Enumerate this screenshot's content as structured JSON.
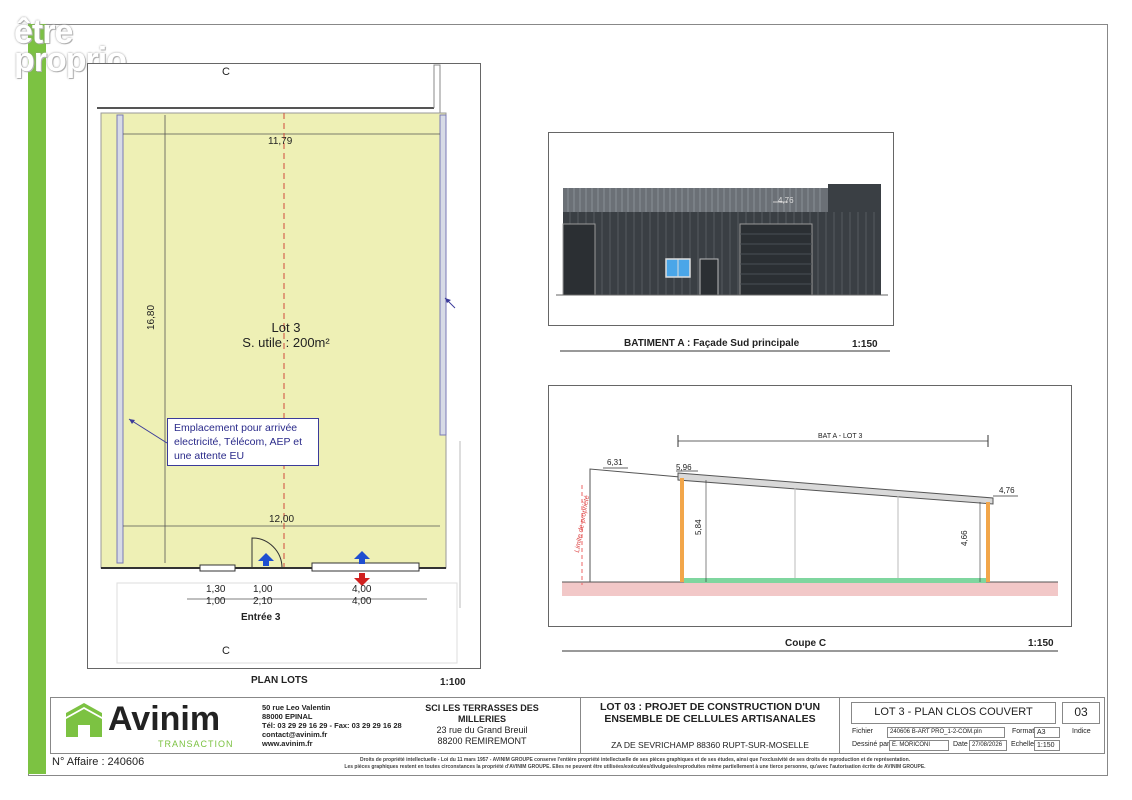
{
  "watermark": {
    "line1": "être",
    "line2": "proprio"
  },
  "plan": {
    "lot_name": "Lot 3",
    "surface": "S. utile : 200m²",
    "dim_top": "11,79",
    "dim_side": "16,80",
    "dim_bottom": "12,00",
    "note": [
      "Emplacement pour arrivée",
      "electricité, Télécom, AEP et",
      "une attente EU"
    ],
    "dims_low": [
      {
        "top": "1,30",
        "bottom": "1,00"
      },
      {
        "top": "1,00",
        "bottom": "2,10"
      },
      {
        "top": "4,00",
        "bottom": "4,00"
      }
    ],
    "entry": "Entrée 3",
    "section_mark": "C",
    "title": "PLAN LOTS",
    "scale": "1:100"
  },
  "facade": {
    "height": "4,76",
    "title": "BATIMENT A : Façade Sud principale",
    "scale": "1:150"
  },
  "section": {
    "label": "BAT A - LOT 3",
    "h_left": "6,31",
    "h_mid": "5,96",
    "h_right": "4,76",
    "h_inner_left": "5,84",
    "h_inner_right": "4,66",
    "limit": "Limite de propriété",
    "title": "Coupe C",
    "scale": "1:150"
  },
  "company": {
    "name": "Avinim",
    "sub": "TRANSACTION",
    "address": [
      "50 rue Leo Valentin",
      "88000 EPINAL",
      "Tél: 03 29 29 16 29 - Fax: 03 29 29 16 28",
      "contact@avinim.fr",
      "www.avinim.fr"
    ],
    "affaire": "N° Affaire : 240606"
  },
  "client": {
    "name": "SCI LES TERRASSES DES MILLERIES",
    "address": [
      "23 rue du Grand Breuil",
      "88200 REMIREMONT"
    ]
  },
  "project": {
    "title": "LOT 03 : PROJET DE CONSTRUCTION D'UN ENSEMBLE DE CELLULES ARTISANALES",
    "location": "ZA DE SEVRICHAMP 88360 RUPT-SUR-MOSELLE"
  },
  "sheet": {
    "title": "LOT 3 - PLAN CLOS COUVERT",
    "number": "03",
    "indice_label": "Indice",
    "fichier_label": "Fichier",
    "fichier": "240606 B-ART PRO_1-2-COM.pln",
    "format_label": "Format",
    "format": "A3",
    "dessine_label": "Dessiné par",
    "dessine": "E. MORICONI",
    "date_label": "Date",
    "date": "27/08/2026",
    "echelle_label": "Echelle",
    "echelle": "1:150"
  },
  "legal": [
    "Droits de propriété intellectuelle - Loi du 11 mars 1957 - AVINIM GROUPE conserve l'entière propriété intellectuelle de ses pièces graphiques et de ses études, ainsi que l'exclusivité de ses droits de reproduction et de représentation.",
    "Les pièces graphiques restent en toutes circonstances la propriété d'AVINIM GROUPE. Elles ne peuvent être utilisées/exécutées/divulguées/reproduites même partiellement à une tierce personne, qu'avec l'autorisation écrite de AVINIM GROUPE."
  ],
  "colors": {
    "green": "#7cc242",
    "lot_fill": "#eef0b5",
    "blue_arrow": "#1f4fd0",
    "red_arrow": "#d0201f"
  }
}
